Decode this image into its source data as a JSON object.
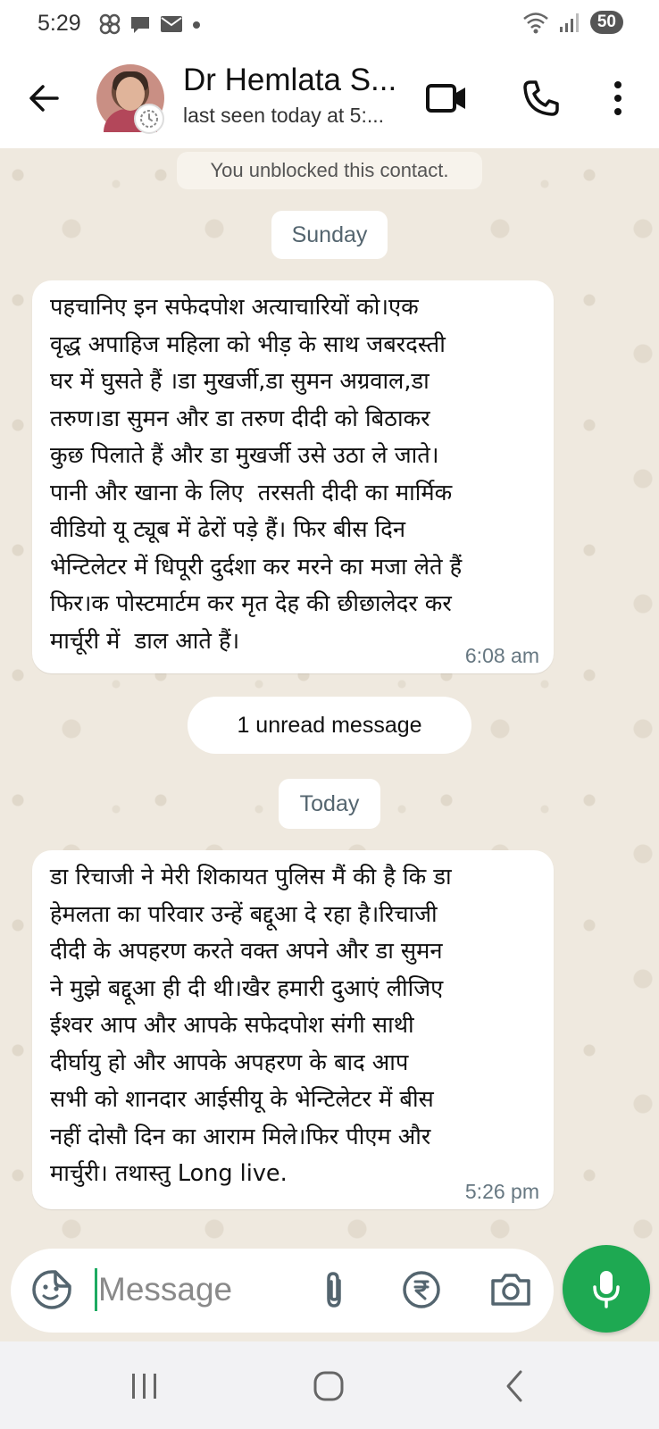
{
  "status_bar": {
    "time": "5:29",
    "battery": "50"
  },
  "header": {
    "contact_name": "Dr Hemlata S...",
    "last_seen": "last seen today at 5:..."
  },
  "chat": {
    "system_note": "You unblocked this contact.",
    "date_divider_1": "Sunday",
    "message_1": {
      "text": "पहचानिए इन सफेदपोश अत्याचारियों को।एक\nवृद्ध अपाहिज महिला को भीड़ के साथ जबरदस्ती\nघर में घुसते हैं ।डा मुखर्जी,डा सुमन अग्रवाल,डा\nतरुण।डा सुमन और डा तरुण दीदी को बिठाकर\nकुछ पिलाते हैं और डा मुखर्जी उसे उठा ले जाते।\nपानी और खाना के लिए  तरसती दीदी का मार्मिक\nवीडियो यू ट्यूब में ढेरों पड़े हैं। फिर बीस दिन\nभेन्टिलेटर में धिपूरी दुर्दशा कर मरने का मजा लेते हैं\nफिर।क पोस्टमार्टम कर मृत देह की छीछालेदर कर\nमार्चूरी में  डाल आते हैं।",
      "time": "6:08 am"
    },
    "unread_divider": "1 unread message",
    "date_divider_2": "Today",
    "message_2": {
      "text": "डा रिचाजी ने मेरी शिकायत पुलिस मैं की है कि डा\nहेमलता का परिवार उन्हें बद्दूआ दे रहा है।रिचाजी\nदीदी के अपहरण करते वक्त अपने और डा सुमन\nने मुझे बद्दूआ ही दी थी।खैर हमारी दुआएं लीजिए\nईश्वर आप और आपके सफेदपोश संगी साथी\nदीर्घायु हो और आपके अपहरण के बाद आप\nसभी को शानदार आईसीयू के भेन्टिलेटर में बीस\nनहीं दोसौ दिन का आराम मिले।फिर पीएम और\nमार्चुरी। तथास्तु Long live.",
      "time": "5:26 pm"
    }
  },
  "composer": {
    "placeholder": "Message"
  },
  "icons": {
    "back": "arrow-back-icon",
    "video": "video-call-icon",
    "call": "phone-icon",
    "menu": "more-vertical-icon",
    "emoji": "sticker-icon",
    "attach": "paperclip-icon",
    "payment": "rupee-icon",
    "camera": "camera-icon",
    "mic": "mic-icon"
  },
  "colors": {
    "accent_green": "#1ea952",
    "chat_background": "#efe9df",
    "bubble": "#ffffff"
  }
}
